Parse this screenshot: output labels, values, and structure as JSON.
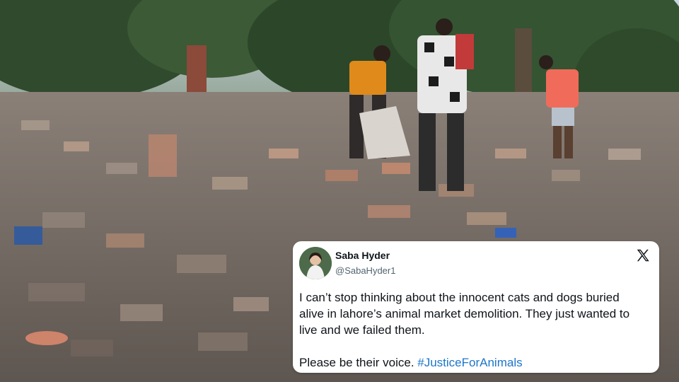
{
  "tweet": {
    "author_name": "Saba Hyder",
    "author_handle": "@SabaHyder1",
    "body_line": "I can’t stop thinking about the innocent cats and dogs buried alive in lahore’s animal market demolition. They just wanted to live and we failed them.",
    "closing_text": "Please be their voice. ",
    "hashtag": "#JusticeForAnimals",
    "platform_icon": "x-logo-icon",
    "hashtag_color": "#1d76c9"
  },
  "photo": {
    "description_icon": "demolition-rubble-photo"
  }
}
